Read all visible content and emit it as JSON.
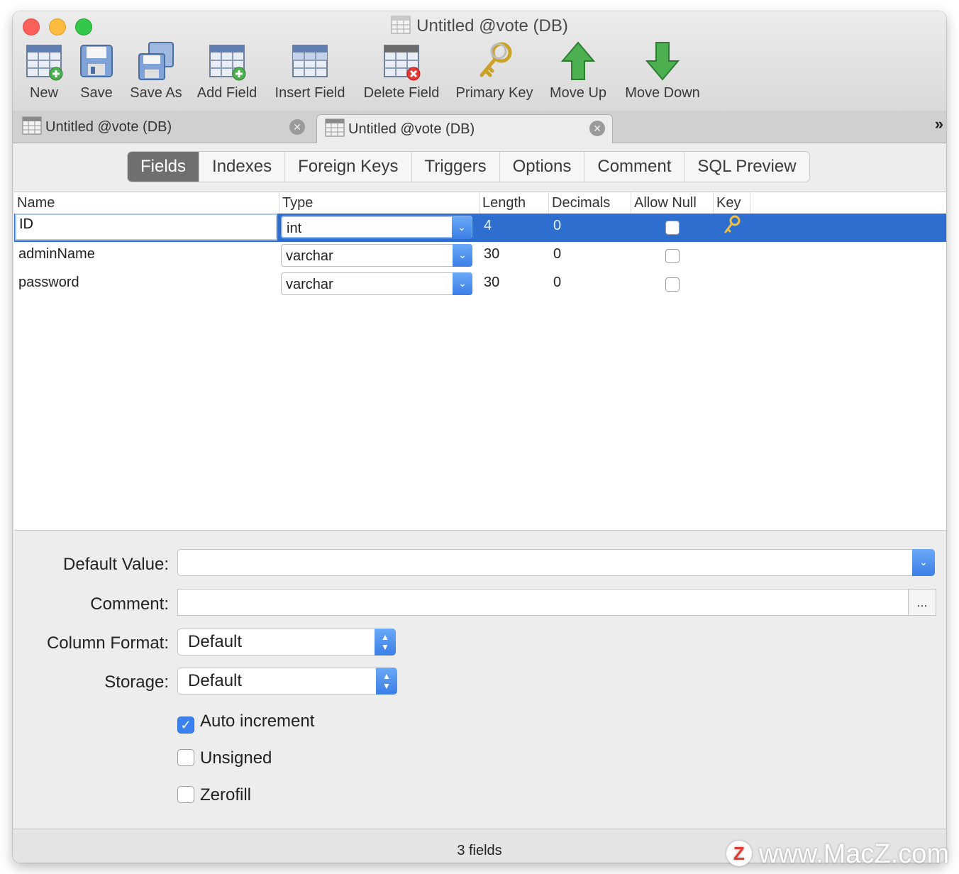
{
  "window": {
    "title": "Untitled @vote (DB)"
  },
  "toolbar": {
    "items": [
      {
        "label": "New",
        "icon": "table-new-icon"
      },
      {
        "label": "Save",
        "icon": "floppy-disk-icon"
      },
      {
        "label": "Save As",
        "icon": "floppy-disks-icon"
      },
      {
        "label": "Add Field",
        "icon": "table-add-icon"
      },
      {
        "label": "Insert Field",
        "icon": "table-insert-icon"
      },
      {
        "label": "Delete Field",
        "icon": "table-delete-icon"
      },
      {
        "label": "Primary Key",
        "icon": "key-icon"
      },
      {
        "label": "Move Up",
        "icon": "arrow-up-icon"
      },
      {
        "label": "Move Down",
        "icon": "arrow-down-icon"
      }
    ]
  },
  "doc_tabs": [
    {
      "label": "Untitled @vote (DB)",
      "active": false
    },
    {
      "label": "Untitled @vote (DB)",
      "active": true
    }
  ],
  "section_tabs": [
    "Fields",
    "Indexes",
    "Foreign Keys",
    "Triggers",
    "Options",
    "Comment",
    "SQL Preview"
  ],
  "active_section": "Fields",
  "grid": {
    "columns": [
      "Name",
      "Type",
      "Length",
      "Decimals",
      "Allow Null",
      "Key"
    ],
    "rows": [
      {
        "name": "ID",
        "type": "int",
        "length": "4",
        "decimals": "0",
        "allow_null": false,
        "key": true
      },
      {
        "name": "adminName",
        "type": "varchar",
        "length": "30",
        "decimals": "0",
        "allow_null": false,
        "key": false
      },
      {
        "name": "password",
        "type": "varchar",
        "length": "30",
        "decimals": "0",
        "allow_null": false,
        "key": false
      }
    ]
  },
  "props": {
    "default_value_label": "Default Value:",
    "default_value": "",
    "comment_label": "Comment:",
    "comment": "",
    "comment_more": "...",
    "column_format_label": "Column Format:",
    "column_format": "Default",
    "storage_label": "Storage:",
    "storage": "Default",
    "auto_increment_label": "Auto increment",
    "auto_increment": true,
    "unsigned_label": "Unsigned",
    "unsigned": false,
    "zerofill_label": "Zerofill",
    "zerofill": false
  },
  "status": "3 fields",
  "watermark": {
    "badge": "Z",
    "text": "www.MacZ.com"
  },
  "colors": {
    "selection": "#2d6ecf",
    "accent": "#3b82f0"
  }
}
